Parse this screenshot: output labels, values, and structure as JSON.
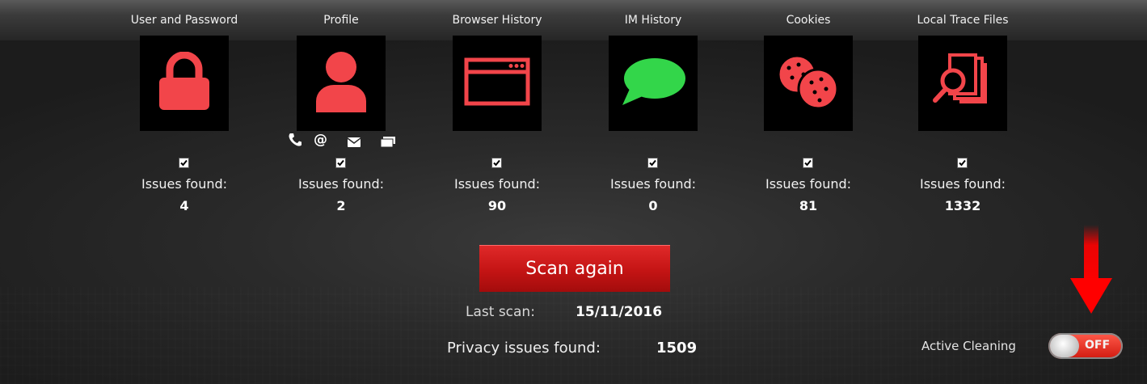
{
  "categories": [
    {
      "id": "user-password",
      "label": "User and Password",
      "icon": "lock-icon",
      "checked": true,
      "issues_label": "Issues found:",
      "count": "4"
    },
    {
      "id": "profile",
      "label": "Profile",
      "icon": "person-icon",
      "checked": true,
      "issues_label": "Issues found:",
      "count": "2"
    },
    {
      "id": "browser-history",
      "label": "Browser History",
      "icon": "browser-window-icon",
      "checked": true,
      "issues_label": "Issues found:",
      "count": "90"
    },
    {
      "id": "im-history",
      "label": "IM History",
      "icon": "speech-bubble-icon",
      "checked": true,
      "issues_label": "Issues found:",
      "count": "0"
    },
    {
      "id": "cookies",
      "label": "Cookies",
      "icon": "cookies-icon",
      "checked": true,
      "issues_label": "Issues found:",
      "count": "81"
    },
    {
      "id": "local-trace-files",
      "label": "Local Trace Files",
      "icon": "magnify-files-icon",
      "checked": true,
      "issues_label": "Issues found:",
      "count": "1332"
    }
  ],
  "profile_contact_icons": [
    "phone-icon",
    "at-sign-icon",
    "envelope-icon",
    "card-icon"
  ],
  "scan": {
    "button_label": "Scan again"
  },
  "last_scan": {
    "label": "Last scan:",
    "value": "15/11/2016"
  },
  "privacy": {
    "label": "Privacy issues found:",
    "value": "1509"
  },
  "active_cleaning": {
    "label": "Active Cleaning",
    "state": "OFF"
  },
  "colors": {
    "accent_red": "#f2454a",
    "im_green": "#33d64a",
    "tile_bg": "#000000",
    "button_red": "#c41414"
  }
}
